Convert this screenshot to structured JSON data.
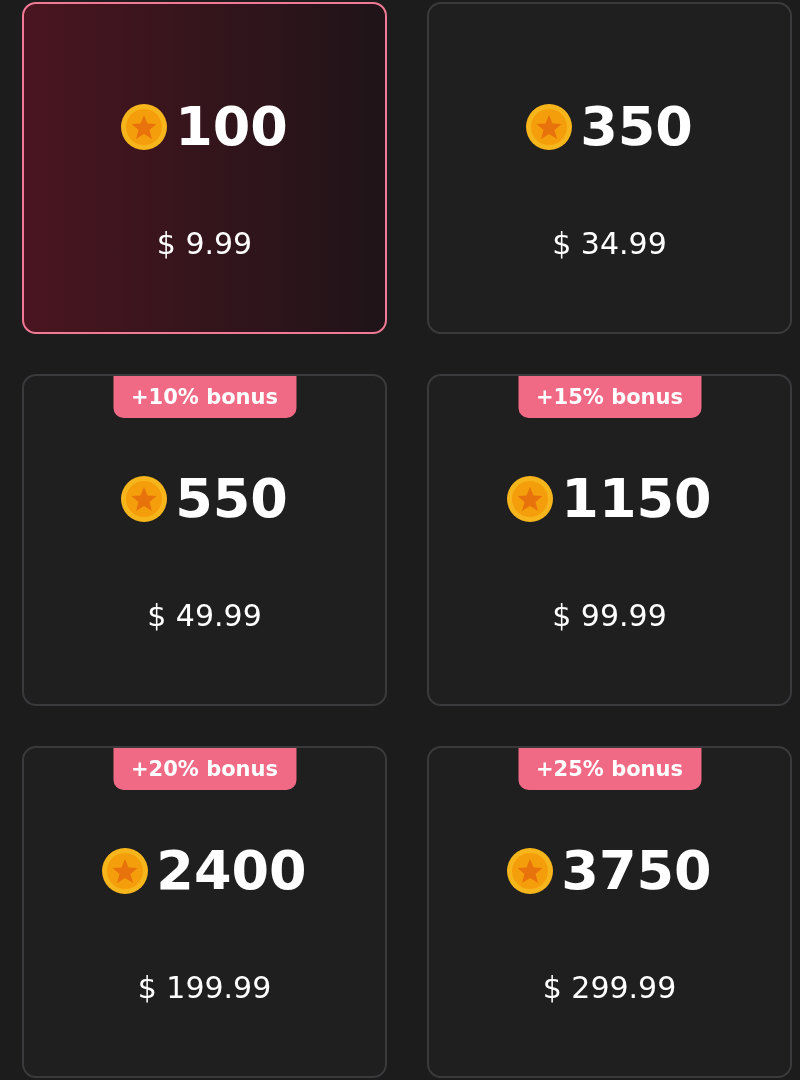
{
  "packs": [
    {
      "coins": "100",
      "price": "$ 9.99",
      "selected": true
    },
    {
      "coins": "350",
      "price": "$ 34.99",
      "selected": false
    },
    {
      "coins": "550",
      "price": "$ 49.99",
      "bonus": "+10% bonus",
      "selected": false
    },
    {
      "coins": "1150",
      "price": "$ 99.99",
      "bonus": "+15% bonus",
      "selected": false
    },
    {
      "coins": "2400",
      "price": "$ 199.99",
      "bonus": "+20% bonus",
      "selected": false
    },
    {
      "coins": "3750",
      "price": "$ 299.99",
      "bonus": "+25% bonus",
      "selected": false
    }
  ]
}
